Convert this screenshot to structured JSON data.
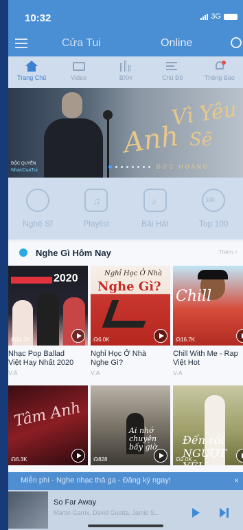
{
  "status": {
    "time": "10:32",
    "network": "3G"
  },
  "header": {
    "tab_left": "Cửa Tui",
    "tab_right": "Online"
  },
  "category_nav": [
    {
      "label": "Trang Chủ",
      "icon": "home-icon",
      "active": true
    },
    {
      "label": "Video",
      "icon": "video-icon"
    },
    {
      "label": "BXH",
      "icon": "chart-icon"
    },
    {
      "label": "Chủ Đề",
      "icon": "topic-icon"
    },
    {
      "label": "Thông Báo",
      "icon": "bell-icon"
    }
  ],
  "banner": {
    "title_line1": "Vì Yêu",
    "title_line2": "Anh",
    "title_line3": "Sẽ",
    "artist": "ĐỨC HOÀNG",
    "badge_top": "ĐỘC QUYỀN",
    "badge_bottom": "NhacCuaTui"
  },
  "quick_actions": [
    {
      "label": "Nghệ Sĩ",
      "icon": "microphone-icon"
    },
    {
      "label": "Playlist",
      "icon": "playlist-icon"
    },
    {
      "label": "Bài Hát",
      "icon": "song-icon"
    },
    {
      "label": "Top 100",
      "icon": "top100-icon",
      "badge": "100"
    }
  ],
  "section": {
    "title": "Nghe Gì Hôm Nay",
    "more": "Thêm >",
    "cards": [
      {
        "title_1": "Nhạc Pop Ballad",
        "title_2": "Việt Hay Nhất 2020",
        "artist": "V.A",
        "listens": "14.3K",
        "art_year": "2020"
      },
      {
        "title_1": "Nghỉ Học Ở Nhà",
        "title_2": "Nghe Gì?",
        "artist": "V.A",
        "listens": "6.0K",
        "art_line1": "Nghỉ Học Ở Nhà",
        "art_line2": "Nghe Gì?"
      },
      {
        "title_1": "Chill With Me - Rap",
        "title_2": "Việt Hot",
        "artist": "V.A",
        "listens": "16.7K",
        "art_text": "Chill"
      },
      {
        "listens": "6.3K",
        "art_text": "Tâm Anh"
      },
      {
        "listens": "828",
        "art_text": "Ai nhớ chuyện bấy giờ"
      },
      {
        "listens": "2.0K",
        "art_text": "Đến rồi NGƯỢT YÊU"
      }
    ]
  },
  "promo": {
    "text": "Miễn phí - Nghe nhạc thả ga - Đăng ký ngay!",
    "close": "×"
  },
  "player": {
    "title": "So Far Away",
    "artist": "Martin Garrix, David Guetta, Jamie S..."
  }
}
